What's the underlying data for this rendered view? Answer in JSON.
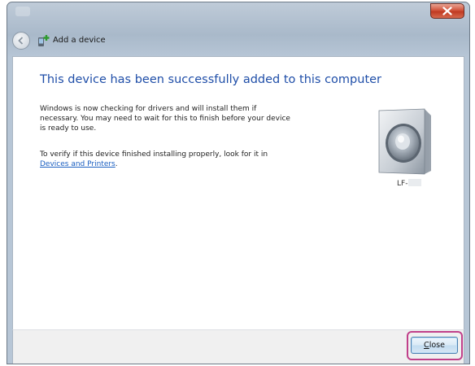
{
  "window": {
    "title": "Add a device"
  },
  "content": {
    "heading": "This device has been successfully added to this computer",
    "para1_line1": "Windows is now checking for drivers and will install them if",
    "para1_line2": "necessary. You may need to wait for this to finish before your device",
    "para1_line3": "is ready to use.",
    "para2_line1": "To verify if this device finished installing properly, look for it in",
    "para2_link": "Devices and Printers",
    "para2_suffix": "."
  },
  "device": {
    "icon": "speaker-icon",
    "label": "LF-"
  },
  "footer": {
    "close_label_first": "C",
    "close_label_rest": "lose"
  },
  "colors": {
    "heading": "#1f4ea8",
    "link": "#1b5fc1",
    "highlight": "#c0408a",
    "titlebar_close": "#c03a22"
  }
}
